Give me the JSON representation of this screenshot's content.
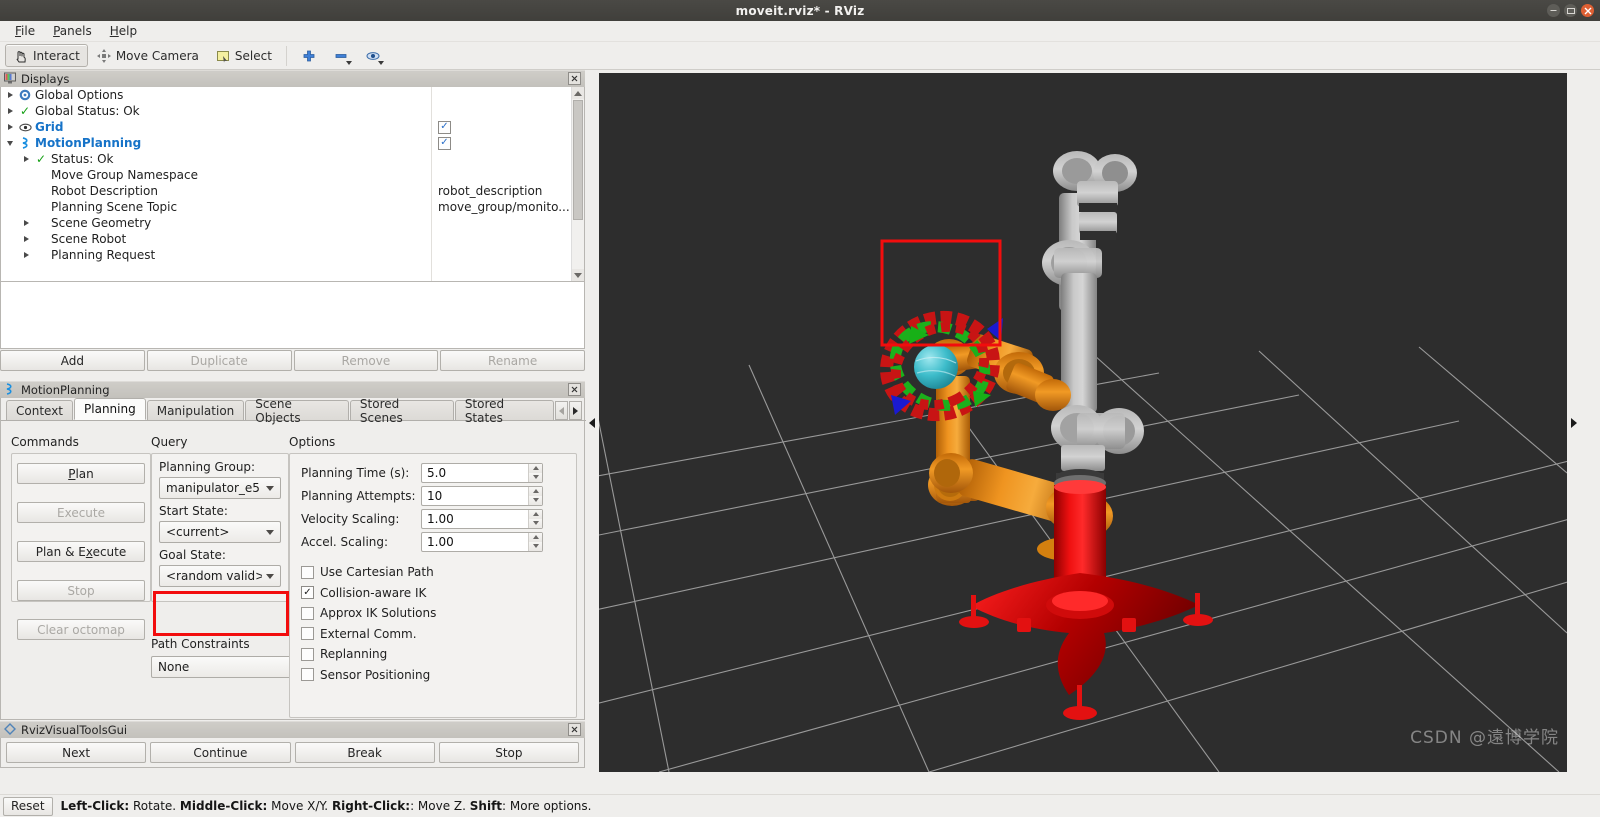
{
  "window": {
    "title": "moveit.rviz* - RViz",
    "controls": [
      "minimize",
      "maximize",
      "close"
    ]
  },
  "menubar": {
    "items": [
      "File",
      "Panels",
      "Help"
    ]
  },
  "toolbar": {
    "buttons": [
      {
        "label": "Interact",
        "icon": "hand-cursor-icon",
        "active": true
      },
      {
        "label": "Move Camera",
        "icon": "move-camera-icon",
        "active": false
      },
      {
        "label": "Select",
        "icon": "select-rectangle-icon",
        "active": false
      }
    ],
    "tools": [
      {
        "icon": "plus-icon",
        "label": ""
      },
      {
        "icon": "minus-icon",
        "label": ""
      },
      {
        "icon": "focus-camera-icon",
        "label": ""
      }
    ]
  },
  "displays_panel": {
    "title": "Displays",
    "close_label": "×",
    "tree": [
      {
        "indent": 0,
        "arrow": "right",
        "icon": "gear-icon",
        "label": "Global Options",
        "blue": false,
        "check": null,
        "value": ""
      },
      {
        "indent": 0,
        "arrow": "right",
        "icon": "status-ok-icon",
        "label": "Global Status: Ok",
        "blue": false,
        "check": null,
        "value": ""
      },
      {
        "indent": 0,
        "arrow": "right",
        "icon": "grid-eye-icon",
        "label": "Grid",
        "blue": true,
        "check": true,
        "value": ""
      },
      {
        "indent": 0,
        "arrow": "down",
        "icon": "motion-planning-icon",
        "label": "MotionPlanning",
        "blue": true,
        "check": true,
        "value": ""
      },
      {
        "indent": 1,
        "arrow": "right",
        "icon": "status-ok-icon",
        "label": "Status: Ok",
        "blue": false,
        "check": null,
        "value": ""
      },
      {
        "indent": 1,
        "arrow": "none",
        "icon": "none",
        "label": "Move Group Namespace",
        "blue": false,
        "check": null,
        "value": ""
      },
      {
        "indent": 1,
        "arrow": "none",
        "icon": "none",
        "label": "Robot Description",
        "blue": false,
        "check": null,
        "value": "robot_description"
      },
      {
        "indent": 1,
        "arrow": "none",
        "icon": "none",
        "label": "Planning Scene Topic",
        "blue": false,
        "check": null,
        "value": "move_group/monito..."
      },
      {
        "indent": 1,
        "arrow": "right",
        "icon": "none",
        "label": "Scene Geometry",
        "blue": false,
        "check": null,
        "value": ""
      },
      {
        "indent": 1,
        "arrow": "right",
        "icon": "none",
        "label": "Scene Robot",
        "blue": false,
        "check": null,
        "value": ""
      },
      {
        "indent": 1,
        "arrow": "right",
        "icon": "none",
        "label": "Planning Request",
        "blue": false,
        "check": null,
        "value": ""
      }
    ],
    "buttons": [
      {
        "label": "Add",
        "enabled": true
      },
      {
        "label": "Duplicate",
        "enabled": false
      },
      {
        "label": "Remove",
        "enabled": false
      },
      {
        "label": "Rename",
        "enabled": false
      }
    ]
  },
  "motion_planning_panel": {
    "title": "MotionPlanning",
    "close_label": "×",
    "tabs": [
      {
        "label": "Context",
        "selected": false
      },
      {
        "label": "Planning",
        "selected": true
      },
      {
        "label": "Manipulation",
        "selected": false
      },
      {
        "label": "Scene Objects",
        "selected": false
      },
      {
        "label": "Stored Scenes",
        "selected": false
      },
      {
        "label": "Stored States",
        "selected": false
      }
    ],
    "commands": {
      "group_label": "Commands",
      "buttons": [
        {
          "label": "Plan",
          "mnemonic": "P",
          "enabled": true
        },
        {
          "label": "Execute",
          "mnemonic": "",
          "enabled": false
        },
        {
          "label": "Plan & Execute",
          "mnemonic": "x",
          "enabled": true
        },
        {
          "label": "Stop",
          "mnemonic": "",
          "enabled": false
        },
        {
          "label": "Clear octomap",
          "mnemonic": "",
          "enabled": false
        }
      ]
    },
    "query": {
      "group_label": "Query",
      "fields": [
        {
          "label": "Planning Group:",
          "value": "manipulator_e5"
        },
        {
          "label": "Start State:",
          "value": "<current>"
        },
        {
          "label": "Goal State:",
          "value": "<random valid>",
          "highlighted": true
        }
      ]
    },
    "path_constraints": {
      "group_label": "Path Constraints",
      "value": "None"
    },
    "options": {
      "group_label": "Options",
      "spinners": [
        {
          "label": "Planning Time (s):",
          "value": "5.0"
        },
        {
          "label": "Planning Attempts:",
          "value": "10"
        },
        {
          "label": "Velocity Scaling:",
          "value": "1.00"
        },
        {
          "label": "Accel. Scaling:",
          "value": "1.00"
        }
      ],
      "checkboxes": [
        {
          "label": "Use Cartesian Path",
          "checked": false
        },
        {
          "label": "Collision-aware IK",
          "checked": true
        },
        {
          "label": "Approx IK Solutions",
          "checked": false
        },
        {
          "label": "External Comm.",
          "checked": false
        },
        {
          "label": "Replanning",
          "checked": false
        },
        {
          "label": "Sensor Positioning",
          "checked": false
        }
      ]
    }
  },
  "rviz_visual_tools_panel": {
    "title": "RvizVisualToolsGui",
    "close_label": "×",
    "buttons": [
      "Next",
      "Continue",
      "Break",
      "Stop"
    ]
  },
  "statusbar": {
    "reset_label": "Reset",
    "hint_segments": [
      {
        "text": "Left-Click:",
        "bold": true
      },
      {
        "text": " Rotate. ",
        "bold": false
      },
      {
        "text": "Middle-Click:",
        "bold": true
      },
      {
        "text": " Move X/Y. ",
        "bold": false
      },
      {
        "text": "Right-Click:",
        "bold": true
      },
      {
        "text": ": Move Z. ",
        "bold": false
      },
      {
        "text": "Shift",
        "bold": true
      },
      {
        "text": ": More options.",
        "bold": false
      }
    ]
  },
  "viewport": {
    "background_color": "#2d2d2d",
    "grid_color": "#b4b4b4",
    "robot_colors": {
      "goal_arm": "#e8891a",
      "current_arm": "#b9b9b9",
      "base": "#e00000",
      "interactive_sphere": "#4ec7d2",
      "ring_red": "#cc1414",
      "ring_green": "#19b019",
      "arrow_blue": "#1a1ad0"
    },
    "selection_box_color": "#f20d0d",
    "handles": {
      "left": "collapse-left-arrow-icon",
      "right": "collapse-right-arrow-icon"
    }
  },
  "watermark": {
    "text": "CSDN @遠博学院"
  }
}
